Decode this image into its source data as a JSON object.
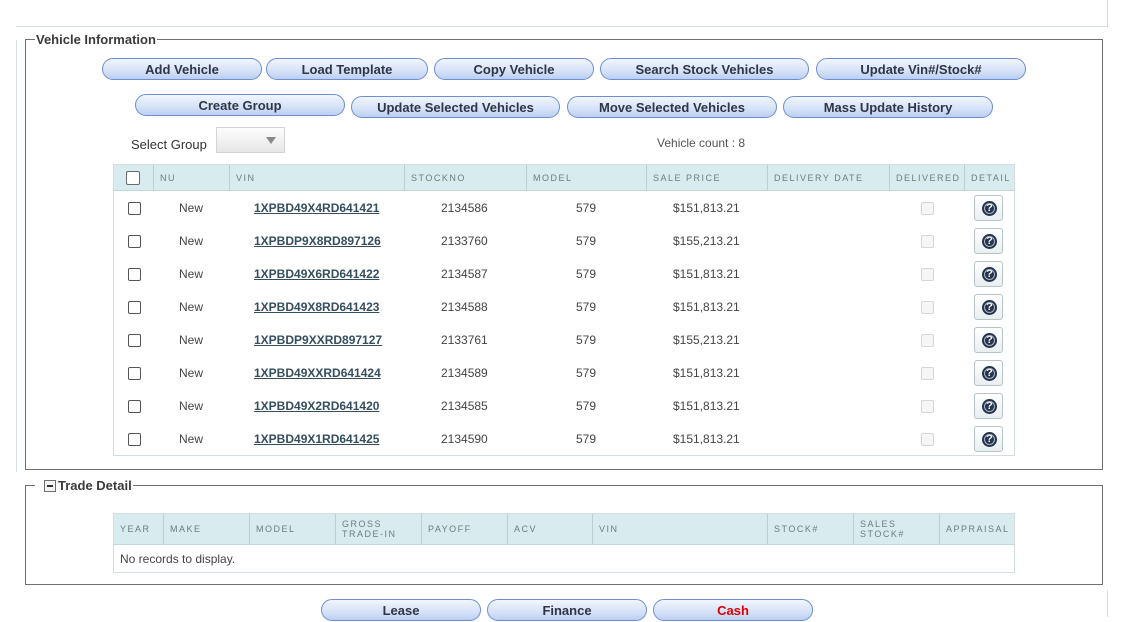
{
  "vehicle_section": {
    "legend": "Vehicle Information",
    "buttons_row1": [
      "Add Vehicle",
      "Load Template",
      "Copy Vehicle",
      "Search Stock Vehicles",
      "Update Vin#/Stock#"
    ],
    "buttons_row2": [
      "Create Group",
      "Update Selected Vehicles",
      "Move Selected Vehicles",
      "Mass Update History"
    ],
    "select_group_label": "Select Group",
    "select_group_value": "",
    "vehicle_count": "Vehicle count : 8",
    "columns": [
      "NU",
      "VIN",
      "STOCKNO",
      "MODEL",
      "SALE PRICE",
      "DELIVERY DATE",
      "DELIVERED",
      "DETAIL"
    ],
    "rows": [
      {
        "nu": "New",
        "vin": "1XPBD49X4RD641421",
        "stockno": "2134586",
        "model": "579",
        "sale_price": "$151,813.21",
        "delivery_date": ""
      },
      {
        "nu": "New",
        "vin": "1XPBDP9X8RD897126",
        "stockno": "2133760",
        "model": "579",
        "sale_price": "$155,213.21",
        "delivery_date": ""
      },
      {
        "nu": "New",
        "vin": "1XPBD49X6RD641422",
        "stockno": "2134587",
        "model": "579",
        "sale_price": "$151,813.21",
        "delivery_date": ""
      },
      {
        "nu": "New",
        "vin": "1XPBD49X8RD641423",
        "stockno": "2134588",
        "model": "579",
        "sale_price": "$151,813.21",
        "delivery_date": ""
      },
      {
        "nu": "New",
        "vin": "1XPBDP9XXRD897127",
        "stockno": "2133761",
        "model": "579",
        "sale_price": "$155,213.21",
        "delivery_date": ""
      },
      {
        "nu": "New",
        "vin": "1XPBD49XXRD641424",
        "stockno": "2134589",
        "model": "579",
        "sale_price": "$151,813.21",
        "delivery_date": ""
      },
      {
        "nu": "New",
        "vin": "1XPBD49X2RD641420",
        "stockno": "2134585",
        "model": "579",
        "sale_price": "$151,813.21",
        "delivery_date": ""
      },
      {
        "nu": "New",
        "vin": "1XPBD49X1RD641425",
        "stockno": "2134590",
        "model": "579",
        "sale_price": "$151,813.21",
        "delivery_date": ""
      }
    ],
    "detail_icon": "help-circle-icon"
  },
  "trade_section": {
    "legend": "Trade Detail",
    "columns": [
      "YEAR",
      "MAKE",
      "MODEL",
      "GROSS TRADE-IN",
      "PAYOFF",
      "ACV",
      "VIN",
      "STOCK#",
      "SALES STOCK#",
      "APPRAISAL"
    ],
    "empty_text": "No records to display."
  },
  "footer_buttons": [
    {
      "label": "Lease",
      "color": "#2f3645"
    },
    {
      "label": "Finance",
      "color": "#2f3645"
    },
    {
      "label": "Cash",
      "color": "#e00000"
    }
  ],
  "colors": {
    "grid_header_bg": "#d8ebee",
    "button_border": "#6d8fd2",
    "cash_text": "#e00000",
    "help_icon": "#25344d"
  }
}
